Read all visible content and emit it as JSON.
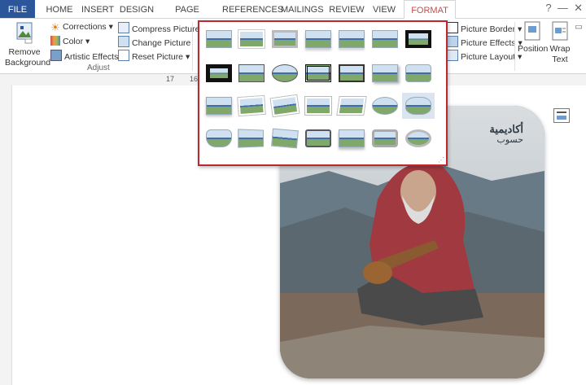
{
  "tabs": [
    "FILE",
    "HOME",
    "INSERT",
    "DESIGN",
    "PAGE LAYOUT",
    "REFERENCES",
    "MAILINGS",
    "REVIEW",
    "VIEW",
    "FORMAT"
  ],
  "ribbon": {
    "remove_background": [
      "Remove",
      "Background"
    ],
    "corrections": "Corrections",
    "color": "Color",
    "artistic_effects": "Artistic Effects",
    "compress_pictures": "Compress Pictures",
    "change_picture": "Change Picture",
    "reset_picture": "Reset Picture",
    "adjust_label": "Adjust",
    "picture_border": "Picture Border",
    "picture_effects": "Picture Effects",
    "picture_layout": "Picture Layout",
    "position": "Position",
    "wrap_text": [
      "Wrap",
      "Text"
    ]
  },
  "ruler_numbers": [
    "17",
    "16"
  ],
  "picture_styles_selected_index": 20,
  "watermark": [
    "أكاديمية",
    "حسوب"
  ],
  "colors": {
    "file_tab": "#2b579a",
    "format_tab_text": "#c0504d",
    "gallery_border": "#c0272d",
    "selected_style_bg": "#dbe5f1"
  }
}
